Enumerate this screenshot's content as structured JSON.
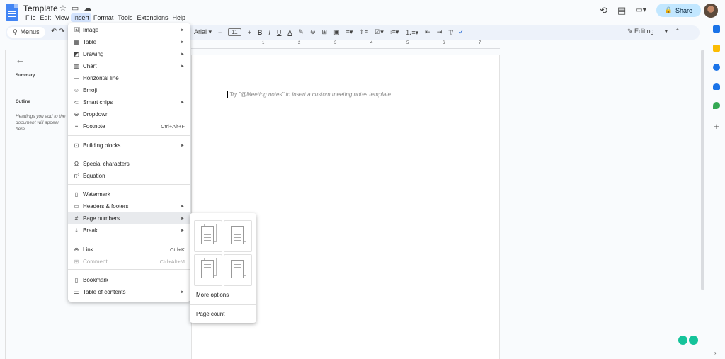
{
  "doc": {
    "title": "Template"
  },
  "menubar": [
    "File",
    "Edit",
    "View",
    "Insert",
    "Format",
    "Tools",
    "Extensions",
    "Help"
  ],
  "toolbar": {
    "menus_label": "Menus",
    "font_name": "Arial",
    "font_size": "11",
    "mode_label": "Editing"
  },
  "share_label": "Share",
  "ruler_numbers": [
    "1",
    "2",
    "3",
    "4",
    "5",
    "6",
    "7"
  ],
  "outline": {
    "summary_label": "Summary",
    "outline_label": "Outline",
    "hint": "Headings you add to the document will appear here."
  },
  "page": {
    "hint": "Try \"@Meeting notes\" to insert a custom meeting notes template"
  },
  "insert_menu": [
    {
      "label": "Image",
      "icon": "image-icon",
      "glyph": "🖼",
      "submenu": true
    },
    {
      "label": "Table",
      "icon": "table-icon",
      "glyph": "▦",
      "submenu": true
    },
    {
      "label": "Drawing",
      "icon": "drawing-icon",
      "glyph": "◩",
      "submenu": true
    },
    {
      "label": "Chart",
      "icon": "chart-icon",
      "glyph": "▥",
      "submenu": true
    },
    {
      "label": "Horizontal line",
      "icon": "horizontal-line-icon",
      "glyph": "—"
    },
    {
      "label": "Emoji",
      "icon": "emoji-icon",
      "glyph": "☺"
    },
    {
      "label": "Smart chips",
      "icon": "smart-chips-icon",
      "glyph": "⊂",
      "submenu": true
    },
    {
      "label": "Dropdown",
      "icon": "dropdown-icon",
      "glyph": "⊖"
    },
    {
      "label": "Footnote",
      "icon": "footnote-icon",
      "glyph": "≡",
      "shortcut": "Ctrl+Alt+F"
    },
    {
      "label": "Building blocks",
      "icon": "building-blocks-icon",
      "glyph": "⊡",
      "submenu": true
    },
    {
      "label": "Special characters",
      "icon": "omega-icon",
      "glyph": "Ω"
    },
    {
      "label": "Equation",
      "icon": "pi-icon",
      "glyph": "π²"
    },
    {
      "label": "Watermark",
      "icon": "watermark-icon",
      "glyph": "▯"
    },
    {
      "label": "Headers & footers",
      "icon": "headers-footers-icon",
      "glyph": "▭",
      "submenu": true
    },
    {
      "label": "Page numbers",
      "icon": "hash-icon",
      "glyph": "#",
      "submenu": true
    },
    {
      "label": "Break",
      "icon": "break-icon",
      "glyph": "⤓",
      "submenu": true
    },
    {
      "label": "Link",
      "icon": "link-icon",
      "glyph": "⊖",
      "shortcut": "Ctrl+K"
    },
    {
      "label": "Comment",
      "icon": "comment-icon",
      "glyph": "⊞",
      "shortcut": "Ctrl+Alt+M"
    },
    {
      "label": "Bookmark",
      "icon": "bookmark-icon",
      "glyph": "▯"
    },
    {
      "label": "Table of contents",
      "icon": "toc-icon",
      "glyph": "☰",
      "submenu": true
    }
  ],
  "page_numbers_submenu": {
    "option_more": "More options",
    "option_count": "Page count"
  }
}
